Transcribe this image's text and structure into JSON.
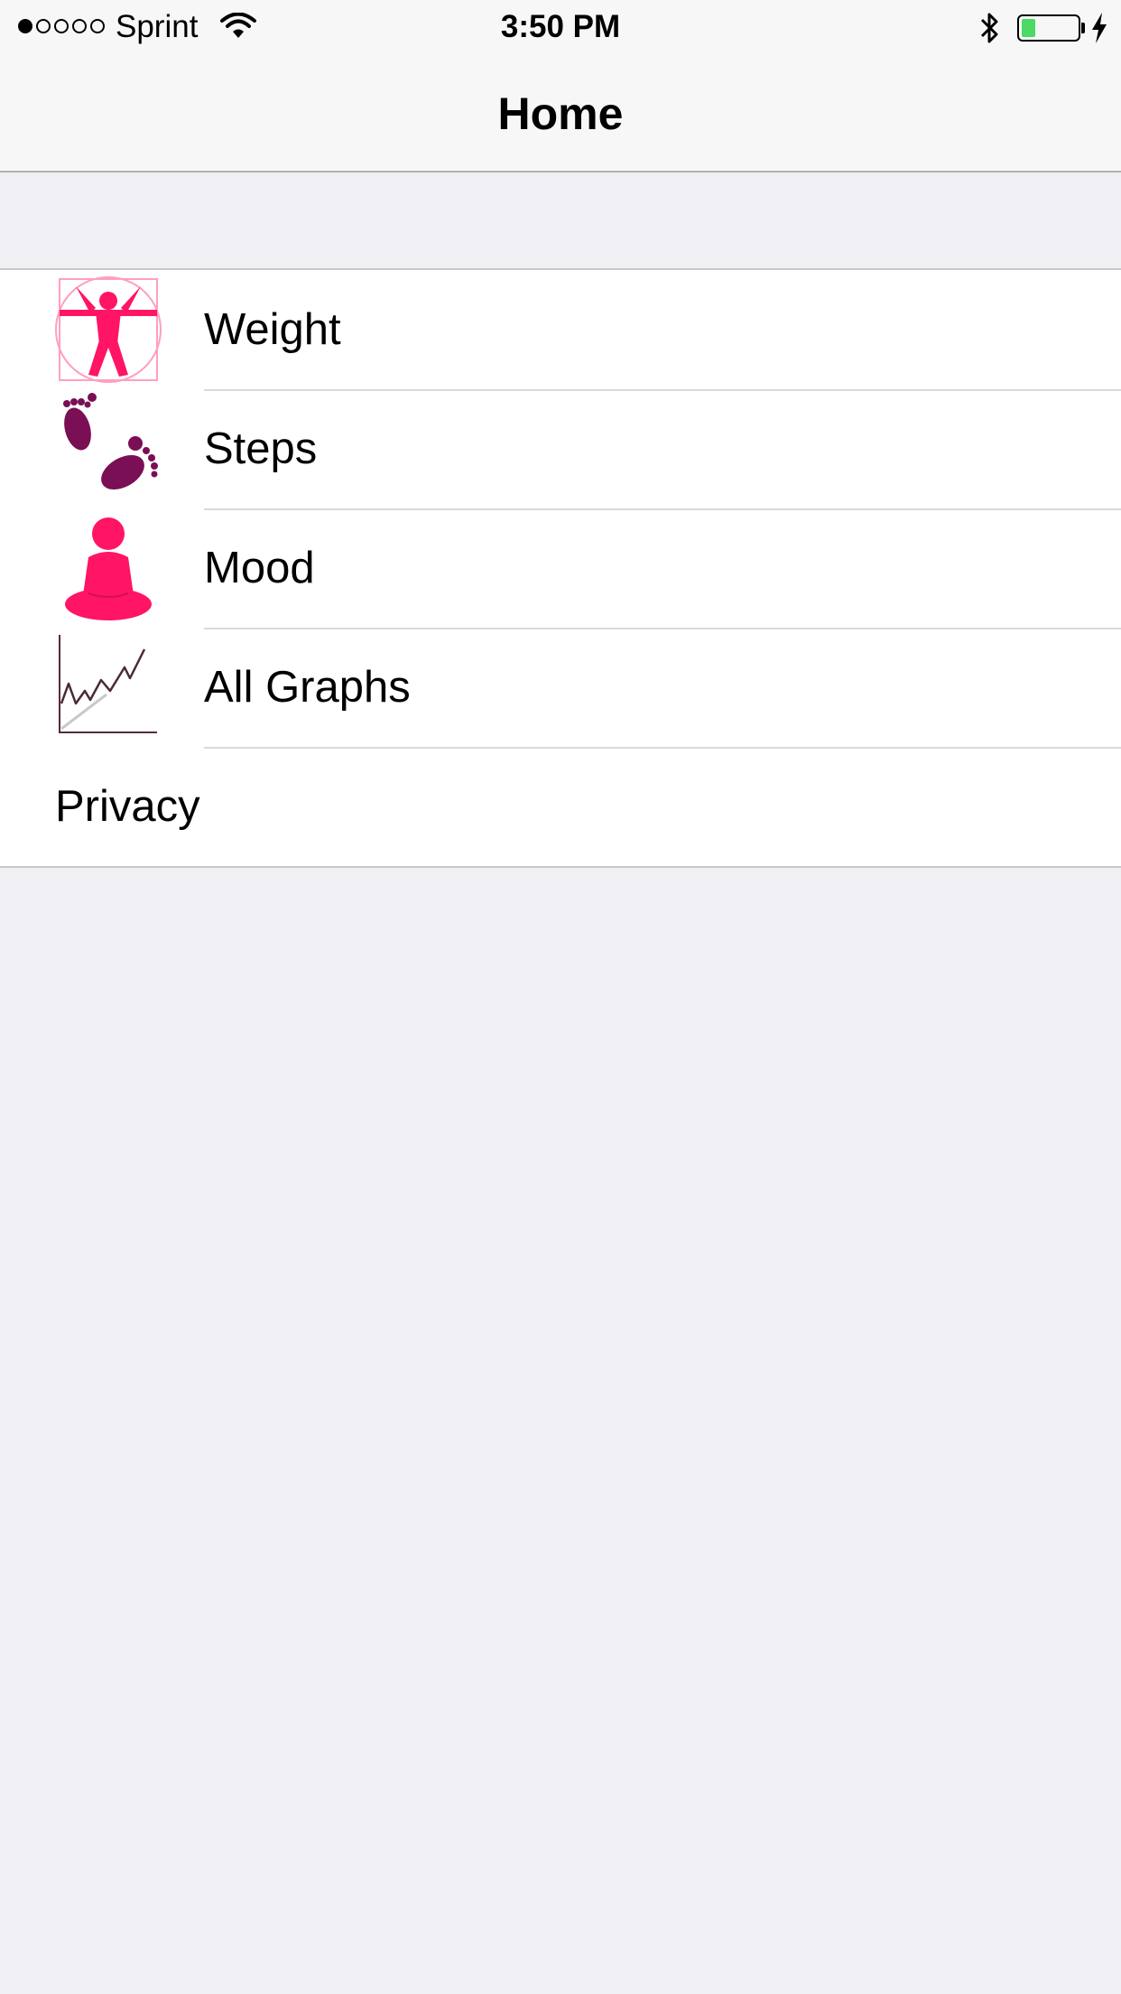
{
  "status_bar": {
    "carrier": "Sprint",
    "signal_bars": 1,
    "signal_total": 5,
    "time": "3:50 PM",
    "battery_level": 0.25,
    "battery_color": "#4cd964"
  },
  "nav": {
    "title": "Home"
  },
  "menu": {
    "items": [
      {
        "label": "Weight",
        "icon": "vitruvian-figure-icon"
      },
      {
        "label": "Steps",
        "icon": "footprints-icon"
      },
      {
        "label": "Mood",
        "icon": "meditation-icon"
      },
      {
        "label": "All Graphs",
        "icon": "line-graph-icon"
      },
      {
        "label": "Privacy",
        "icon": ""
      }
    ]
  },
  "colors": {
    "accent_pink": "#ff1466",
    "accent_plum": "#6e0f4e",
    "background": "#efeff4"
  }
}
